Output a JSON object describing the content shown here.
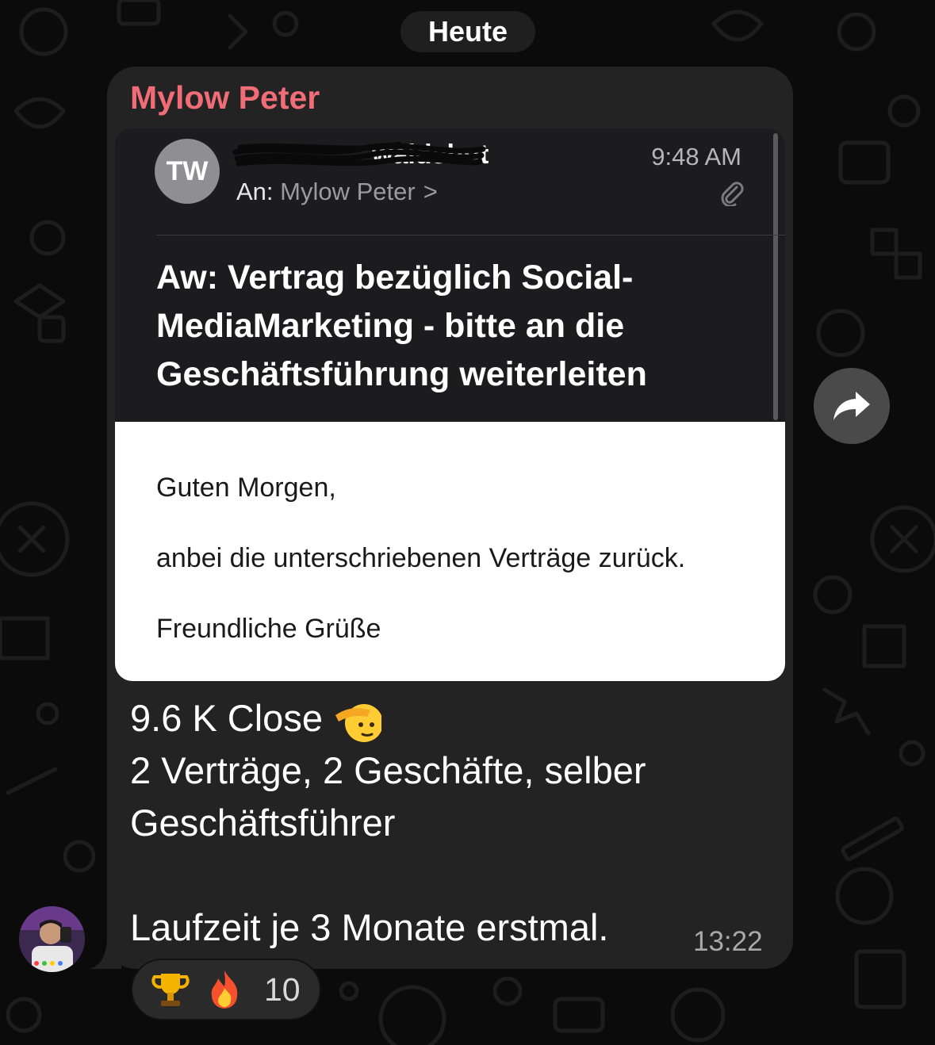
{
  "date_separator": "Heute",
  "message": {
    "sender_name": "Mylow Peter",
    "lines": [
      "9.6 K Close",
      "2 Verträge, 2 Geschäfte, selber",
      "Geschäftsführer",
      "Laufzeit je 3 Monate erstmal."
    ],
    "timestamp": "13:22"
  },
  "email_screenshot": {
    "avatar_initials": "TW",
    "from_visible": "waldshut",
    "time": "9:48 AM",
    "to_label": "An:",
    "to_name": "Mylow Peter",
    "to_chevron": ">",
    "subject": "Aw: Vertrag bezüglich Social-MediaMarketing - bitte an die Geschäftsführung weiterleiten",
    "body_lines": [
      "Guten Morgen,",
      "anbei die unterschriebenen Verträge zurück.",
      "Freundliche Grüße"
    ]
  },
  "reactions": {
    "emojis": [
      "trophy",
      "fire"
    ],
    "count": "10"
  },
  "icons": {
    "forward": "forward-arrow-icon",
    "attachment": "paperclip-icon",
    "salute": "saluting-face-emoji"
  },
  "colors": {
    "sender_name": "#f06c77",
    "bubble": "#232323",
    "background": "#0b0b0b"
  }
}
